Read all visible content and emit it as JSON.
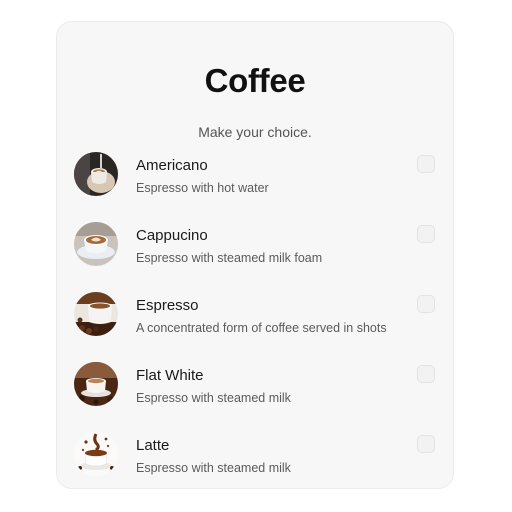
{
  "header": {
    "title": "Coffee",
    "subtitle": "Make your choice."
  },
  "options": [
    {
      "name": "Americano",
      "description": "Espresso with hot water",
      "icon": "americano-photo-icon",
      "checked": false
    },
    {
      "name": "Cappucino",
      "description": "Espresso with steamed milk foam",
      "icon": "cappucino-photo-icon",
      "checked": false
    },
    {
      "name": "Espresso",
      "description": "A concentrated form of coffee served in shots",
      "icon": "espresso-photo-icon",
      "checked": false
    },
    {
      "name": "Flat White",
      "description": "Espresso with steamed milk",
      "icon": "flat-white-photo-icon",
      "checked": false
    },
    {
      "name": "Latte",
      "description": "Espresso with steamed milk",
      "icon": "latte-photo-icon",
      "checked": false
    }
  ],
  "colors": {
    "card_background": "#f7f7f7",
    "title": "#111111",
    "text_secondary": "#5b5b5b"
  }
}
